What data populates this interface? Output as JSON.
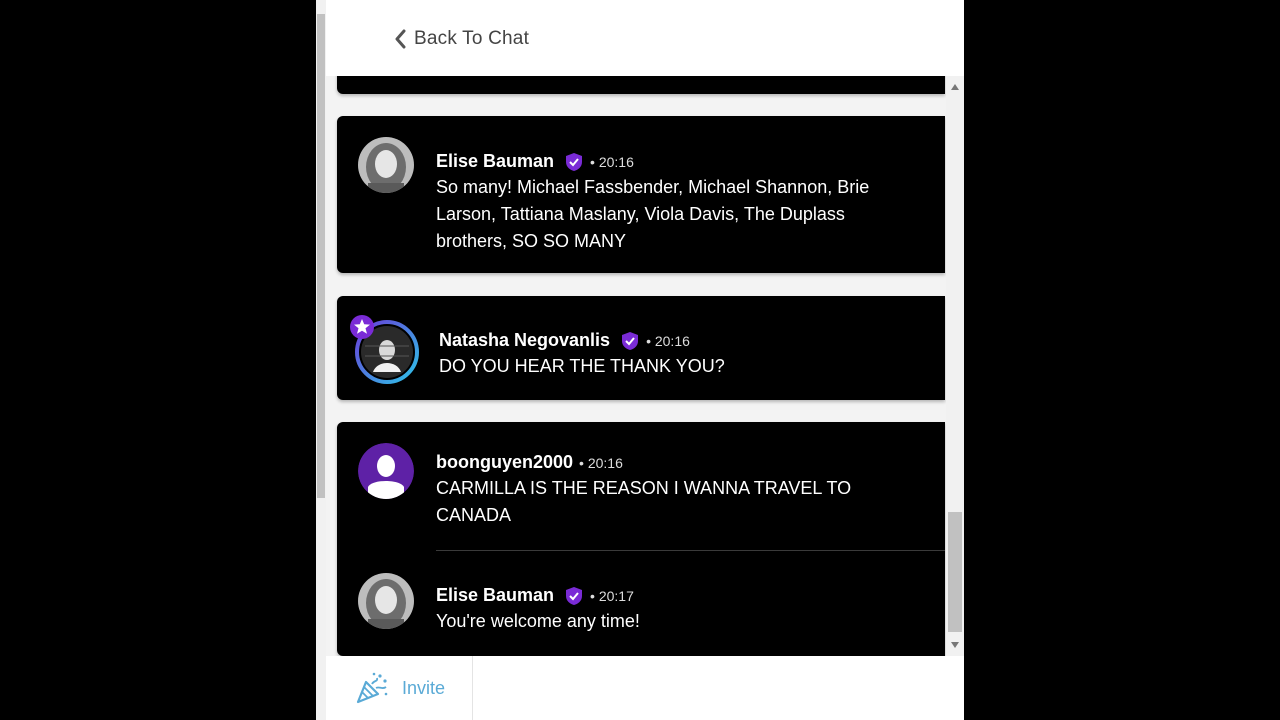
{
  "header": {
    "back_label": "Back To Chat"
  },
  "messages": [
    {
      "author": "Elise Bauman",
      "verified": true,
      "time": "• 20:16",
      "lines": [
        "So many! Michael Fassbender, Michael Shannon, Brie",
        "Larson, Tattiana Maslany, Viola Davis, The Duplass",
        "brothers, SO SO MANY"
      ]
    },
    {
      "author": "Natasha Negovanlis",
      "verified": true,
      "featured": true,
      "time": "• 20:16",
      "lines": [
        "DO YOU HEAR THE THANK YOU?"
      ]
    },
    {
      "author": "boonguyen2000",
      "verified": false,
      "time": "• 20:16",
      "lines": [
        "CARMILLA IS THE REASON I WANNA TRAVEL TO",
        "CANADA"
      ]
    },
    {
      "author": "Elise Bauman",
      "verified": true,
      "time": "• 20:17",
      "lines": [
        "You're welcome any time!"
      ]
    }
  ],
  "footer": {
    "invite_label": "Invite"
  },
  "colors": {
    "accent_purple": "#7a2bd6",
    "invite_blue": "#5aaad6",
    "card_bg": "#000000",
    "panel_bg": "#f3f3f3"
  },
  "icons": {
    "back": "chevron-left-icon",
    "verified": "verified-shield-icon",
    "featured": "star-badge-icon",
    "invite": "party-popper-icon"
  }
}
